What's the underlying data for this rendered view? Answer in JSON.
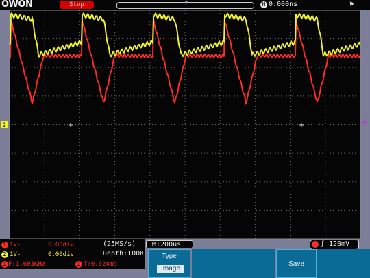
{
  "brand": {
    "logo_text": "OWON"
  },
  "topbar": {
    "status": "Stop",
    "time_icon": "H",
    "time_offset": "0.000ns",
    "trig_marker_icon": "trigger-position-marker"
  },
  "channels": [
    {
      "id": "1",
      "scale": "1V-",
      "position": "0.00div",
      "color": "#ff2a2a"
    },
    {
      "id": "2",
      "scale": "1V-",
      "position": "0.00div",
      "color": "#f0f02c"
    }
  ],
  "acquisition": {
    "sample_rate": "(25MS/s)",
    "depth": "Depth:100K"
  },
  "measurements": {
    "frequency": "F:1.603KHz",
    "period": "T:0.624ms"
  },
  "timebase": "M:200us",
  "trigger": {
    "channel": "1",
    "edge_icon": "rising-edge-icon",
    "level": "120mV"
  },
  "markers": {
    "ch2_ground": "2"
  },
  "softkeys": {
    "type_label": "Type",
    "type_value": "Image",
    "save_label": "Save"
  },
  "colors": {
    "ch1": "#ff2a2a",
    "ch2": "#f0f02c",
    "screen_bg": "#050505",
    "grid": "#5a5a5a",
    "menu": "#0a6c96"
  }
}
